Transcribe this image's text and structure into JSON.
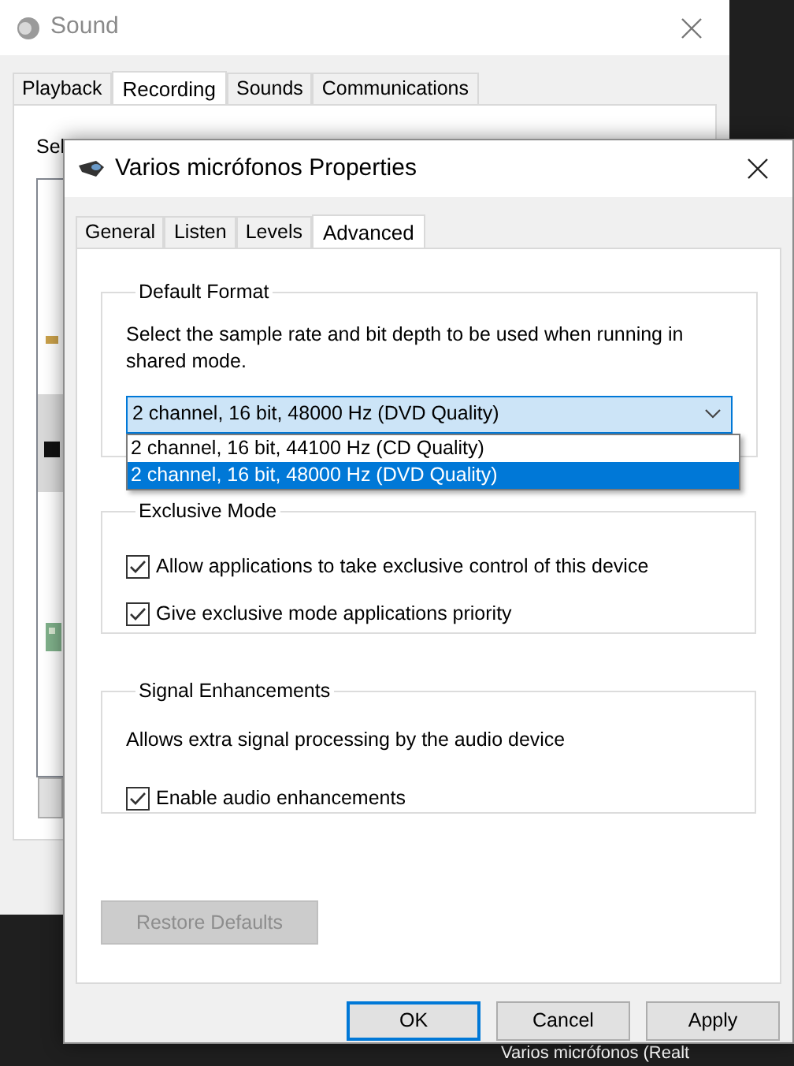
{
  "sound_window": {
    "title": "Sound",
    "tabs": [
      {
        "label": "Playback",
        "selected": false
      },
      {
        "label": "Recording",
        "selected": true
      },
      {
        "label": "Sounds",
        "selected": false
      },
      {
        "label": "Communications",
        "selected": false
      }
    ],
    "panel_text": "Sel"
  },
  "dialog": {
    "title": "Varios micrófonos Properties",
    "tabs": [
      {
        "label": "General",
        "selected": false
      },
      {
        "label": "Listen",
        "selected": false
      },
      {
        "label": "Levels",
        "selected": false
      },
      {
        "label": "Advanced",
        "selected": true
      }
    ],
    "default_format": {
      "heading": "Default Format",
      "description": "Select the sample rate and bit depth to be used when running in shared mode.",
      "dropdown": {
        "value": "2 channel, 16 bit, 48000 Hz (DVD Quality)",
        "expanded": true,
        "options": [
          {
            "label": "2 channel, 16 bit, 44100 Hz (CD Quality)",
            "selected": false
          },
          {
            "label": "2 channel, 16 bit, 48000 Hz (DVD Quality)",
            "selected": true
          }
        ]
      }
    },
    "exclusive_mode": {
      "heading": "Exclusive Mode",
      "options": [
        {
          "label": "Allow applications to take exclusive control of this device",
          "checked": true
        },
        {
          "label": "Give exclusive mode applications priority",
          "checked": true
        }
      ]
    },
    "signal_enhancements": {
      "heading": "Signal Enhancements",
      "description": "Allows extra signal processing by the audio device",
      "options": [
        {
          "label": "Enable audio enhancements",
          "checked": true
        }
      ]
    },
    "restore_defaults": {
      "label": "Restore Defaults",
      "disabled": true
    },
    "buttons": [
      {
        "label": "OK",
        "default": true
      },
      {
        "label": "Cancel",
        "default": false
      },
      {
        "label": "Apply",
        "default": false
      }
    ]
  },
  "background_label": "Varios micrófonos (Realt"
}
